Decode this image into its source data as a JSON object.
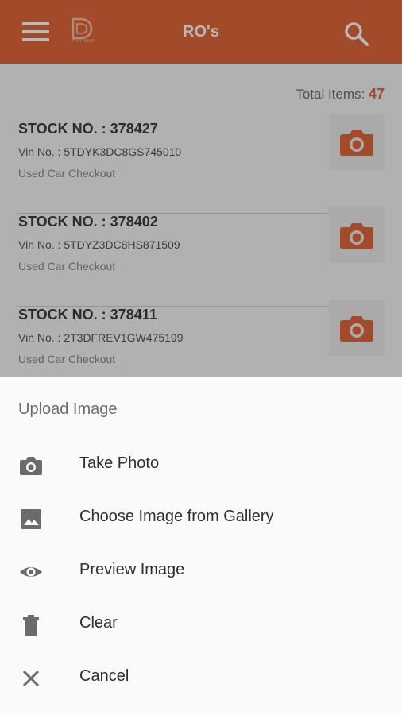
{
  "app_bar": {
    "title": "RO's",
    "logo_text": "PLATINUM",
    "menu_icon": "menu-icon",
    "search_icon": "search-icon",
    "color": "#e1673a"
  },
  "list": {
    "total_label": "Total Items:",
    "total_count": "47",
    "items": [
      {
        "stock": "STOCK NO. : 378427",
        "vin": "Vin No. : 5TDYK3DC8GS745010",
        "type": "Used Car Checkout"
      },
      {
        "stock": "STOCK NO. : 378402",
        "vin": "Vin No. : 5TDYZ3DC8HS871509",
        "type": "Used Car Checkout"
      },
      {
        "stock": "STOCK NO. : 378411",
        "vin": "Vin No. : 2T3DFREV1GW475199",
        "type": "Used Car Checkout"
      }
    ]
  },
  "sheet": {
    "title": "Upload Image",
    "options": [
      {
        "label": "Take Photo",
        "icon": "camera-icon"
      },
      {
        "label": "Choose Image from Gallery",
        "icon": "image-icon"
      },
      {
        "label": "Preview Image",
        "icon": "eye-icon"
      },
      {
        "label": "Clear",
        "icon": "trash-icon"
      },
      {
        "label": "Cancel",
        "icon": "close-icon"
      }
    ]
  }
}
